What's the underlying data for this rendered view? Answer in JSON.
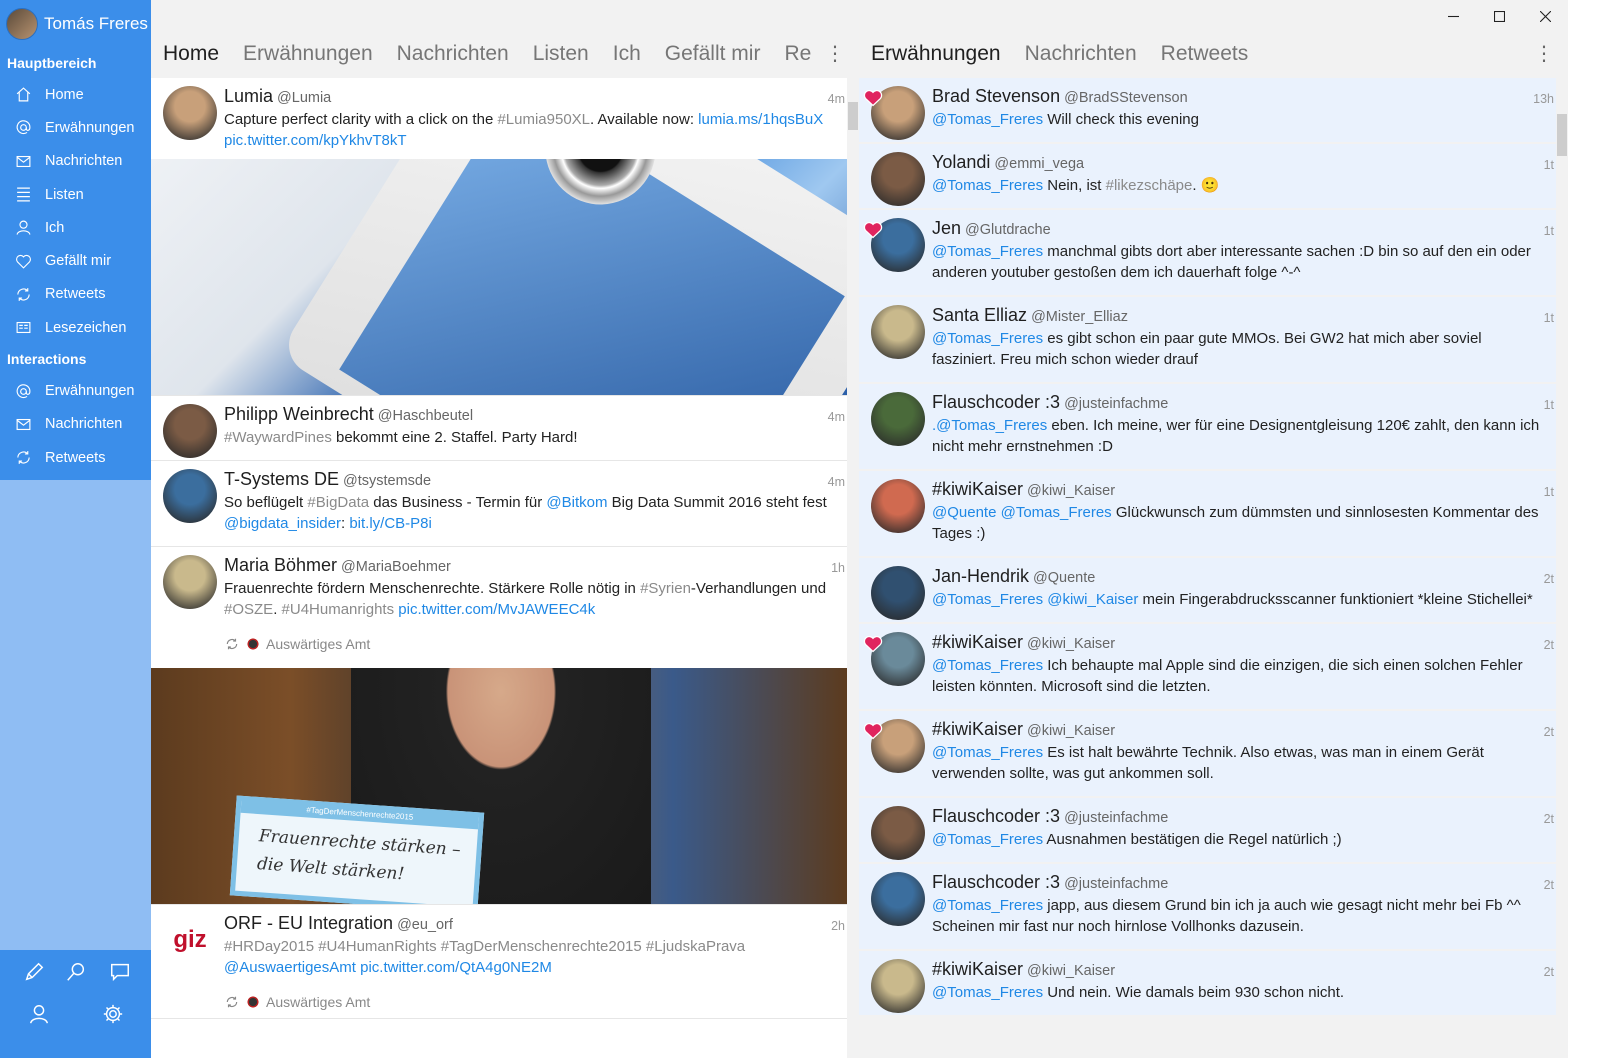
{
  "account": {
    "name": "Tomás Freres"
  },
  "sidebar": {
    "main_heading": "Hauptbereich",
    "main_items": [
      {
        "label": "Home",
        "icon": "home-icon"
      },
      {
        "label": "Erwähnungen",
        "icon": "at-icon"
      },
      {
        "label": "Nachrichten",
        "icon": "mail-icon"
      },
      {
        "label": "Listen",
        "icon": "list-icon"
      },
      {
        "label": "Ich",
        "icon": "person-icon"
      },
      {
        "label": "Gefällt mir",
        "icon": "heart-icon"
      },
      {
        "label": "Retweets",
        "icon": "retweet-icon"
      },
      {
        "label": "Lesezeichen",
        "icon": "bookmark-icon"
      }
    ],
    "interactions_heading": "Interactions",
    "interaction_items": [
      {
        "label": "Erwähnungen",
        "icon": "at-icon"
      },
      {
        "label": "Nachrichten",
        "icon": "mail-icon"
      },
      {
        "label": "Retweets",
        "icon": "retweet-icon"
      }
    ],
    "colors": {
      "primary": "#3b8eea",
      "light": "#8fbdf3"
    }
  },
  "column1": {
    "tabs": [
      "Home",
      "Erwähnungen",
      "Nachrichten",
      "Listen",
      "Ich",
      "Gefällt mir",
      "Re"
    ],
    "more": "⋮",
    "tweets": [
      {
        "name": "Lumia",
        "handle": "@Lumia",
        "time": "4m",
        "text": [
          [
            "Capture perfect clarity with a click on the ",
            "t"
          ],
          [
            "#Lumia950XL",
            "h"
          ],
          [
            ". Available now: ",
            "t"
          ],
          [
            "lumia.ms/1hqsBuX",
            "l"
          ],
          [
            " ",
            "t"
          ],
          [
            "pic.twitter.com/kpYkhvT8kT",
            "l"
          ]
        ]
      },
      {
        "name": "Philipp Weinbrecht",
        "handle": "@Haschbeutel",
        "time": "4m",
        "text": [
          [
            "#WaywardPines",
            "h"
          ],
          [
            " bekommt eine 2. Staffel. Party Hard!",
            "t"
          ]
        ]
      },
      {
        "name": "T-Systems DE",
        "handle": "@tsystemsde",
        "time": "4m",
        "text": [
          [
            "So beflügelt ",
            "t"
          ],
          [
            "#BigData",
            "h"
          ],
          [
            " das Business - Termin für ",
            "t"
          ],
          [
            "@Bitkom",
            "l"
          ],
          [
            " Big Data Summit 2016 steht fest ",
            "t"
          ],
          [
            "@bigdata_insider",
            "l"
          ],
          [
            ": ",
            "t"
          ],
          [
            "bit.ly/CB-P8i",
            "l"
          ]
        ]
      },
      {
        "name": "Maria Böhmer",
        "handle": "@MariaBoehmer",
        "time": "1h",
        "text": [
          [
            "Frauenrechte fördern Menschenrechte. Stärkere Rolle nötig in ",
            "t"
          ],
          [
            "#Syrien",
            "h"
          ],
          [
            "-Verhandlungen und ",
            "t"
          ],
          [
            "#OSZE",
            "h"
          ],
          [
            ". ",
            "t"
          ],
          [
            "#U4Humanrights",
            "h"
          ],
          [
            " ",
            "t"
          ],
          [
            "pic.twitter.com/MvJAWEEC4k",
            "l"
          ]
        ],
        "retweeted_by": "Auswärtiges Amt",
        "media_sign": "Frauenrechte stärken – die Welt stärken!",
        "media_sign_banner": "#TagDerMenschenrechte2015"
      },
      {
        "name": "ORF - EU Integration",
        "handle": "@eu_orf",
        "time": "2h",
        "text": [
          [
            "#HRDay2015 #U4HumanRights #TagDerMenschenrechte2015 #LjudskaPrava",
            "h"
          ],
          [
            " ",
            "t"
          ],
          [
            "@AuswaertigesAmt",
            "l"
          ],
          [
            " ",
            "t"
          ],
          [
            "pic.twitter.com/QtA4g0NE2M",
            "l"
          ]
        ],
        "retweeted_by": "Auswärtiges Amt",
        "avatar_text": "giz"
      }
    ]
  },
  "column2": {
    "tabs": [
      "Erwähnungen",
      "Nachrichten",
      "Retweets"
    ],
    "more": "⋮",
    "tweets": [
      {
        "name": "Brad Stevenson",
        "handle": "@BradSStevenson",
        "time": "13h",
        "liked": true,
        "text": [
          [
            "@Tomas_Freres",
            "l"
          ],
          [
            " Will check this evening",
            "t"
          ]
        ]
      },
      {
        "name": "Yolandi",
        "handle": "@emmi_vega",
        "time": "1t",
        "liked": false,
        "text": [
          [
            "@Tomas_Freres",
            "l"
          ],
          [
            " Nein, ist ",
            "t"
          ],
          [
            "#likezschäpe",
            "h"
          ],
          [
            ". 🙂",
            "t"
          ]
        ]
      },
      {
        "name": "Jen",
        "handle": "@Glutdrache",
        "time": "1t",
        "liked": true,
        "text": [
          [
            "@Tomas_Freres",
            "l"
          ],
          [
            " manchmal gibts dort aber interessante sachen :D bin so auf den ein oder anderen youtuber gestoßen dem ich dauerhaft folge ^-^",
            "t"
          ]
        ]
      },
      {
        "name": "Santa Elliaz",
        "handle": "@Mister_Elliaz",
        "time": "1t",
        "liked": false,
        "text": [
          [
            "@Tomas_Freres",
            "l"
          ],
          [
            " es gibt schon ein paar gute MMOs. Bei GW2 hat mich aber soviel fasziniert. Freu mich schon wieder drauf",
            "t"
          ]
        ]
      },
      {
        "name": "Flauschcoder :3",
        "handle": "@justeinfachme",
        "time": "1t",
        "liked": false,
        "text": [
          [
            ".@Tomas_Freres",
            "l"
          ],
          [
            " eben. Ich meine, wer für eine Designentgleisung 120€ zahlt, den kann ich nicht mehr ernstnehmen :D",
            "t"
          ]
        ]
      },
      {
        "name": "#kiwiKaiser",
        "handle": "@kiwi_Kaiser",
        "time": "1t",
        "liked": false,
        "text": [
          [
            "@Quente @Tomas_Freres",
            "l"
          ],
          [
            " Glückwunsch zum dümmsten und sinnlosesten Kommentar des Tages :)",
            "t"
          ]
        ]
      },
      {
        "name": "Jan-Hendrik",
        "handle": "@Quente",
        "time": "2t",
        "liked": false,
        "text": [
          [
            "@Tomas_Freres @kiwi_Kaiser",
            "l"
          ],
          [
            " mein Fingerabdrucksscanner funktioniert *kleine Stichellei*",
            "t"
          ]
        ]
      },
      {
        "name": "#kiwiKaiser",
        "handle": "@kiwi_Kaiser",
        "time": "2t",
        "liked": true,
        "text": [
          [
            "@Tomas_Freres",
            "l"
          ],
          [
            " Ich behaupte mal Apple sind die einzigen, die sich einen solchen Fehler leisten könnten. Microsoft sind die letzten.",
            "t"
          ]
        ]
      },
      {
        "name": "#kiwiKaiser",
        "handle": "@kiwi_Kaiser",
        "time": "2t",
        "liked": true,
        "text": [
          [
            "@Tomas_Freres",
            "l"
          ],
          [
            " Es ist halt bewährte Technik. Also etwas, was man in einem Gerät verwenden sollte, was gut ankommen soll.",
            "t"
          ]
        ]
      },
      {
        "name": "Flauschcoder :3",
        "handle": "@justeinfachme",
        "time": "2t",
        "liked": false,
        "text": [
          [
            "@Tomas_Freres",
            "l"
          ],
          [
            " Ausnahmen bestätigen die Regel natürlich ;)",
            "t"
          ]
        ]
      },
      {
        "name": "Flauschcoder :3",
        "handle": "@justeinfachme",
        "time": "2t",
        "liked": false,
        "text": [
          [
            "@Tomas_Freres",
            "l"
          ],
          [
            " japp, aus diesem Grund bin ich ja auch wie gesagt nicht mehr bei Fb ^^ Scheinen mir fast nur noch hirnlose Vollhonks dazusein.",
            "t"
          ]
        ]
      },
      {
        "name": "#kiwiKaiser",
        "handle": "@kiwi_Kaiser",
        "time": "2t",
        "liked": false,
        "text": [
          [
            "@Tomas_Freres",
            "l"
          ],
          [
            " Und nein. Wie damals beim 930 schon nicht.",
            "t"
          ]
        ]
      }
    ]
  },
  "colors": {
    "link": "#1f88e5",
    "hashtag": "#8a8a8a",
    "like": "#e0245e",
    "mention_bg": "#eaf2fd"
  }
}
